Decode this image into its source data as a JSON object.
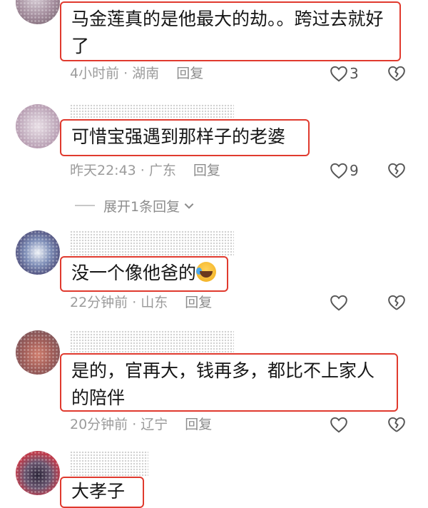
{
  "comments": [
    {
      "text": "马金莲真的是他最大的劫。。跨过去就好了",
      "time": "4小时前",
      "location": "湖南",
      "reply_label": "回复",
      "likes": "3"
    },
    {
      "text": "可惜宝强遇到那样子的老婆",
      "time": "昨天22:43",
      "location": "广东",
      "reply_label": "回复",
      "likes": "9",
      "expand_label": "展开1条回复"
    },
    {
      "text": "没一个像他爸的",
      "emoji": "laughing-crying-emoji",
      "time": "22分钟前",
      "location": "山东",
      "reply_label": "回复",
      "likes": ""
    },
    {
      "text": "是的，官再大，钱再多，都比不上家人的陪伴",
      "time": "20分钟前",
      "location": "辽宁",
      "reply_label": "回复",
      "likes": ""
    },
    {
      "text": "大孝子"
    }
  ],
  "separator": "·",
  "colors": {
    "highlight_border": "#e03a2e",
    "meta_text": "#9b9b9b"
  }
}
